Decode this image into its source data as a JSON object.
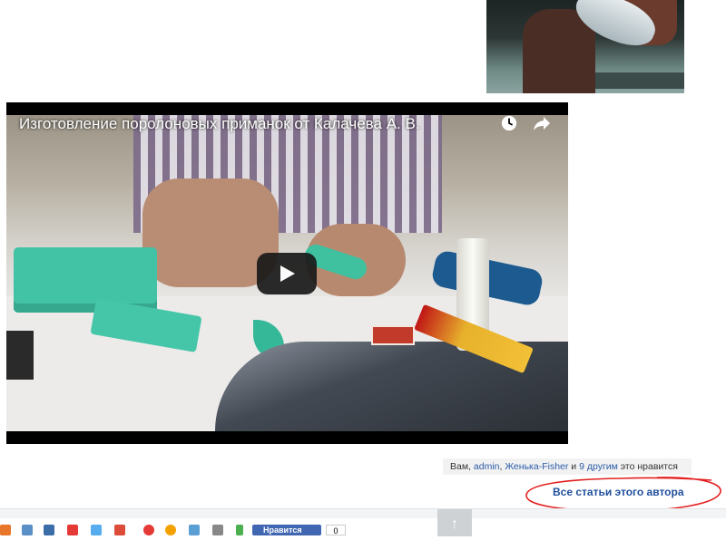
{
  "video": {
    "title": "Изготовление поролоновых приманок от Калачева А. В."
  },
  "likes": {
    "prefix": "Вам,",
    "user1": "admin",
    "comma": ",",
    "user2": "Женька-Fisher",
    "and": "и",
    "others": "9 другим",
    "suffix": "это нравится"
  },
  "author": {
    "all_articles_label": "Все статьи этого автора"
  },
  "share": {
    "fb_label": "Нравится",
    "fb_count": "0",
    "icon_colors": [
      "#e8762b",
      "#5a8fc7",
      "#3b6ea8",
      "#e53935",
      "#55acee",
      "#dd4b39",
      "#e53935",
      "#f4a200",
      "#5a9fd4",
      "#888888",
      "#4caf50"
    ],
    "icons": [
      "blogger-icon",
      "mail-ru-icon",
      "vk-icon",
      "livejournal-icon",
      "twitter-icon",
      "google-plus-icon",
      "odnoklassniki-icon",
      "moi-mir-icon",
      "email-icon",
      "print-icon",
      "download-icon"
    ]
  },
  "scroll_top": {
    "label": "↑"
  }
}
